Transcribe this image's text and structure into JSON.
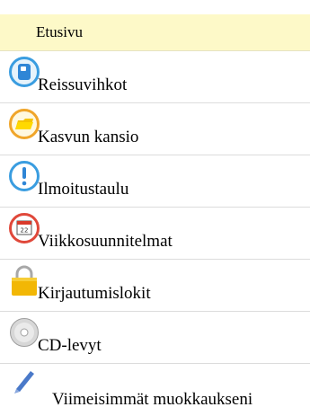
{
  "menu": {
    "home": {
      "label": "Etusivu"
    },
    "items": [
      {
        "label": "Reissuvihkot",
        "icon": "notebook-icon"
      },
      {
        "label": "Kasvun kansio",
        "icon": "folder-icon"
      },
      {
        "label": "Ilmoitustaulu",
        "icon": "exclamation-icon"
      },
      {
        "label": "Viikkosuunnitelmat",
        "icon": "calendar-icon",
        "calendar_day": "22"
      },
      {
        "label": "Kirjautumislokit",
        "icon": "padlock-icon"
      },
      {
        "label": "CD-levyt",
        "icon": "cd-icon"
      },
      {
        "label": "Viimeisimmät muokkaukseni",
        "icon": "pen-icon"
      }
    ]
  }
}
